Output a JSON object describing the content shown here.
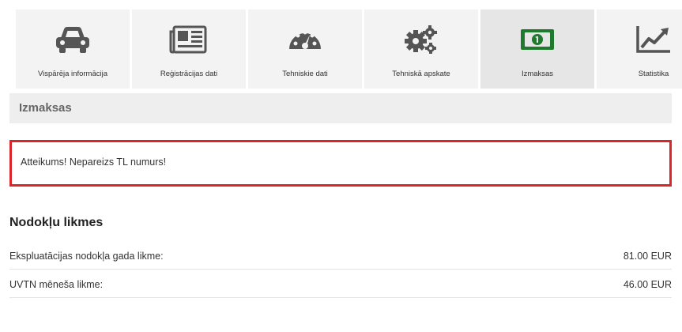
{
  "tabs": [
    {
      "label": "Vispārēja informācija",
      "icon": "car-icon"
    },
    {
      "label": "Reģistrācijas dati",
      "icon": "newspaper-icon"
    },
    {
      "label": "Tehniskie dati",
      "icon": "speedometer-icon"
    },
    {
      "label": "Tehniskā apskate",
      "icon": "gears-icon"
    },
    {
      "label": "Izmaksas",
      "icon": "banknote-icon",
      "active": true
    },
    {
      "label": "Statistika",
      "icon": "line-chart-icon"
    }
  ],
  "section": {
    "title": "Izmaksas"
  },
  "error": {
    "message": "Atteikums! Nepareizs TL numurs!"
  },
  "taxes": {
    "heading": "Nodokļu likmes",
    "rows": [
      {
        "label": "Ekspluatācijas nodokļa gada likme:",
        "value": "81.00 EUR"
      },
      {
        "label": "UVTN mēneša likme:",
        "value": "46.00 EUR"
      }
    ]
  },
  "colors": {
    "accent_green": "#1f7a2e",
    "error_red": "#d9262b",
    "icon_gray": "#555555"
  }
}
